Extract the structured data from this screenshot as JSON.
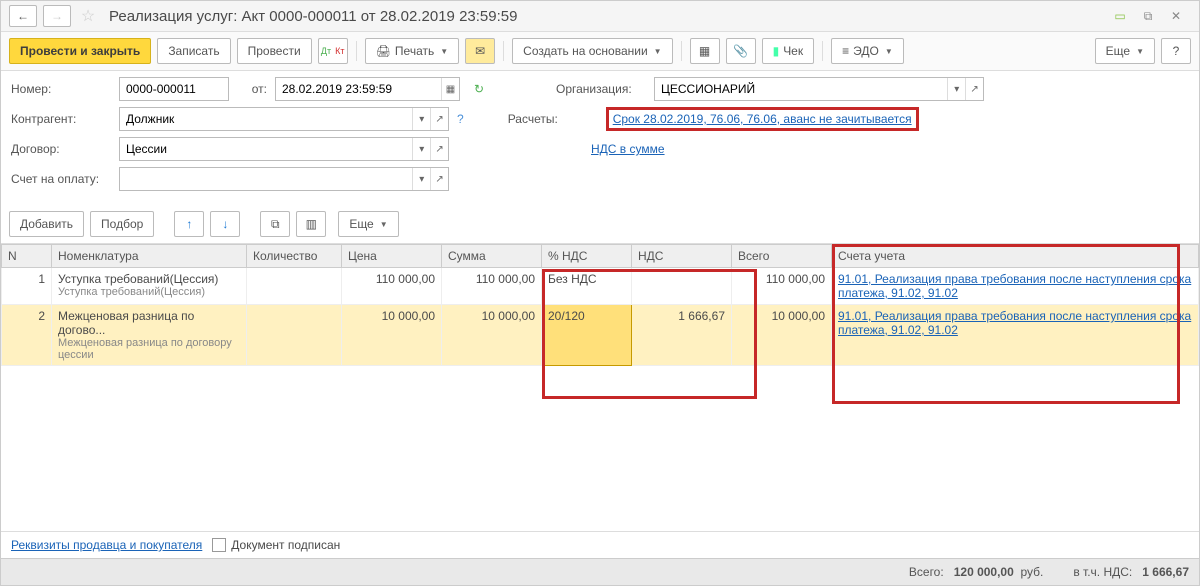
{
  "title": "Реализация услуг: Акт 0000-000011 от 28.02.2019 23:59:59",
  "toolbar": {
    "post_close": "Провести и закрыть",
    "save": "Записать",
    "post": "Провести",
    "print": "Печать",
    "create_based": "Создать на основании",
    "check": "Чек",
    "edo": "ЭДО",
    "more": "Еще"
  },
  "form": {
    "number_label": "Номер:",
    "number": "0000-000011",
    "from_label": "от:",
    "date": "28.02.2019 23:59:59",
    "org_label": "Организация:",
    "org": "ЦЕССИОНАРИЙ",
    "counter_label": "Контрагент:",
    "counter": "Должник",
    "calc_label": "Расчеты:",
    "calc_link": "Срок 28.02.2019, 76.06, 76.06, аванс не зачитывается",
    "contract_label": "Договор:",
    "contract": "Цессии",
    "vat_link": "НДС в сумме",
    "invoice_label": "Счет на оплату:",
    "invoice": ""
  },
  "table_toolbar": {
    "add": "Добавить",
    "select": "Подбор",
    "more": "Еще"
  },
  "columns": {
    "n": "N",
    "nomen": "Номенклатура",
    "qty": "Количество",
    "price": "Цена",
    "sum": "Сумма",
    "vatp": "% НДС",
    "vat": "НДС",
    "total": "Всего",
    "acct": "Счета учета"
  },
  "rows": [
    {
      "n": "1",
      "nomen": "Уступка требований(Цессия)",
      "nomen_sub": "Уступка требований(Цессия)",
      "qty": "",
      "price": "110 000,00",
      "sum": "110 000,00",
      "vatp": "Без НДС",
      "vat": "",
      "total": "110 000,00",
      "acct": "91.01, Реализация права требования после наступления срока платежа, 91.02, 91.02"
    },
    {
      "n": "2",
      "nomen": "Межценовая разница по догово...",
      "nomen_sub": "Межценовая разница по договору цессии",
      "qty": "",
      "price": "10 000,00",
      "sum": "10 000,00",
      "vatp": "20/120",
      "vat": "1 666,67",
      "total": "10 000,00",
      "acct": "91.01, Реализация права требования после наступления срока платежа, 91.02, 91.02"
    }
  ],
  "footer": {
    "requisites": "Реквизиты продавца и покупателя",
    "signed": "Документ подписан"
  },
  "status": {
    "total_label": "Всего:",
    "total": "120 000,00",
    "currency": "руб.",
    "vat_label": "в т.ч. НДС:",
    "vat": "1 666,67"
  }
}
